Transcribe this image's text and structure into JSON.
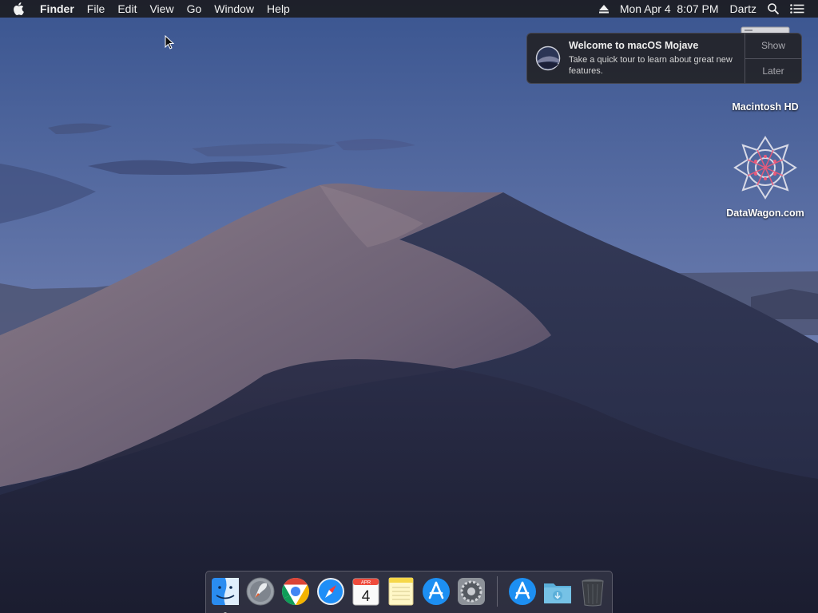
{
  "menubar": {
    "app_name": "Finder",
    "menus": [
      "File",
      "Edit",
      "View",
      "Go",
      "Window",
      "Help"
    ],
    "datetime": "Mon Apr 4  8:07 PM",
    "user": "Dartz"
  },
  "notification": {
    "title": "Welcome to macOS Mojave",
    "message": "Take a quick tour to learn about great new features.",
    "show_label": "Show",
    "later_label": "Later"
  },
  "desktop_icons": [
    {
      "label": "Macintosh HD",
      "icon": "hard-drive-icon"
    },
    {
      "label": "DataWagon.com",
      "icon": "network-share-icon"
    }
  ],
  "dock": {
    "items": [
      {
        "name": "finder",
        "icon": "finder-icon",
        "running": true
      },
      {
        "name": "launchpad",
        "icon": "launchpad-icon"
      },
      {
        "name": "chrome",
        "icon": "chrome-icon"
      },
      {
        "name": "safari",
        "icon": "safari-icon"
      },
      {
        "name": "calendar",
        "icon": "calendar-icon",
        "month": "APR",
        "day": "4"
      },
      {
        "name": "notes",
        "icon": "notes-icon"
      },
      {
        "name": "app-store",
        "icon": "app-store-icon"
      },
      {
        "name": "system-preferences",
        "icon": "system-preferences-icon"
      },
      {
        "name": "app-store-download",
        "icon": "app-store-icon"
      },
      {
        "name": "downloads",
        "icon": "downloads-folder-icon"
      },
      {
        "name": "trash",
        "icon": "trash-icon"
      }
    ]
  },
  "colors": {
    "sky_top": "#3f5a93",
    "sky_bottom": "#7f8db8",
    "dune_light": "#7b6e7c",
    "dune_dark": "#1c1f33",
    "menubar_bg": "#1c1c22"
  }
}
